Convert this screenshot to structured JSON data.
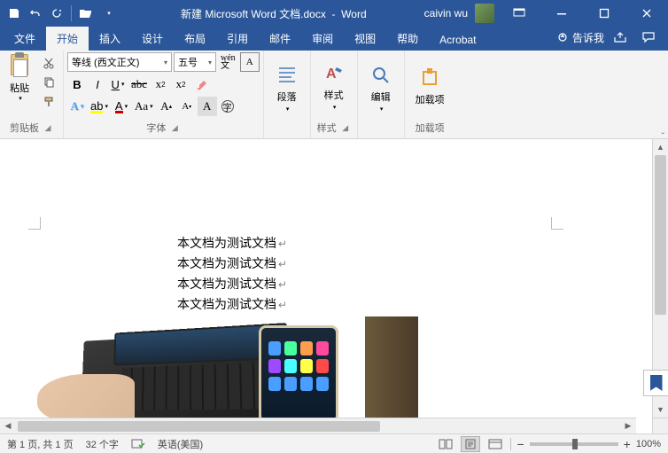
{
  "title": {
    "doc": "新建 Microsoft Word 文档.docx",
    "sep": "-",
    "app": "Word"
  },
  "user": "caivin wu",
  "tabs": {
    "file": "文件",
    "home": "开始",
    "insert": "插入",
    "design": "设计",
    "layout": "布局",
    "references": "引用",
    "mailings": "邮件",
    "review": "审阅",
    "view": "视图",
    "help": "帮助",
    "acrobat": "Acrobat",
    "tellme": "告诉我"
  },
  "groups": {
    "clipboard": "剪贴板",
    "font": "字体",
    "paragraph": "段落",
    "styles": "样式",
    "editing": "编辑",
    "addins": "加载项"
  },
  "paste": "粘贴",
  "font": {
    "name": "等线 (西文正文)",
    "size": "五号"
  },
  "buttons": {
    "paragraph": "段落",
    "styles": "样式",
    "editing": "编辑",
    "addin": "加载项"
  },
  "doc": {
    "l1": "本文档为测试文档",
    "l2": "本文档为测试文档",
    "l3": "本文档为测试文档",
    "l4": "本文档为测试文档"
  },
  "status": {
    "page": "第 1 页, 共 1 页",
    "words": "32 个字",
    "lang": "英语(美国)",
    "zoom": "100%"
  }
}
